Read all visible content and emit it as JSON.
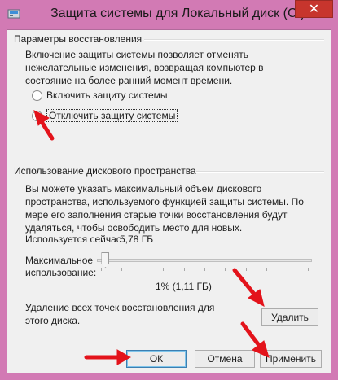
{
  "window": {
    "title": "Защита системы для Локальный диск (C:)",
    "close_label": "✕"
  },
  "restore": {
    "group_title": "Параметры восстановления",
    "description": "Включение защиты системы позволяет отменять нежелательные изменения, возвращая компьютер в состояние на более ранний момент времени.",
    "option_enable": "Включить защиту системы",
    "option_disable": "Отключить защиту системы",
    "selected": "disable"
  },
  "disk": {
    "group_title": "Использование дискового пространства",
    "description": "Вы можете указать максимальный объем дискового пространства, используемого функцией защиты системы. По мере его заполнения старые точки восстановления будут удаляться, чтобы освободить место для новых.",
    "current_label": "Используется сейчас:",
    "current_value": "5,78 ГБ",
    "max_label_line1": "Максимальное",
    "max_label_line2": "использование:",
    "slider_value_text": "1% (1,11 ГБ)",
    "slider_percent": 1,
    "delete_text": "Удаление всех точек восстановления для этого диска.",
    "delete_button": "Удалить"
  },
  "buttons": {
    "ok": "ОК",
    "cancel": "Отмена",
    "apply": "Применить"
  },
  "colors": {
    "accent_arrow": "#e3131b",
    "window_frame": "#d27ab4",
    "close_button": "#c7352d"
  }
}
